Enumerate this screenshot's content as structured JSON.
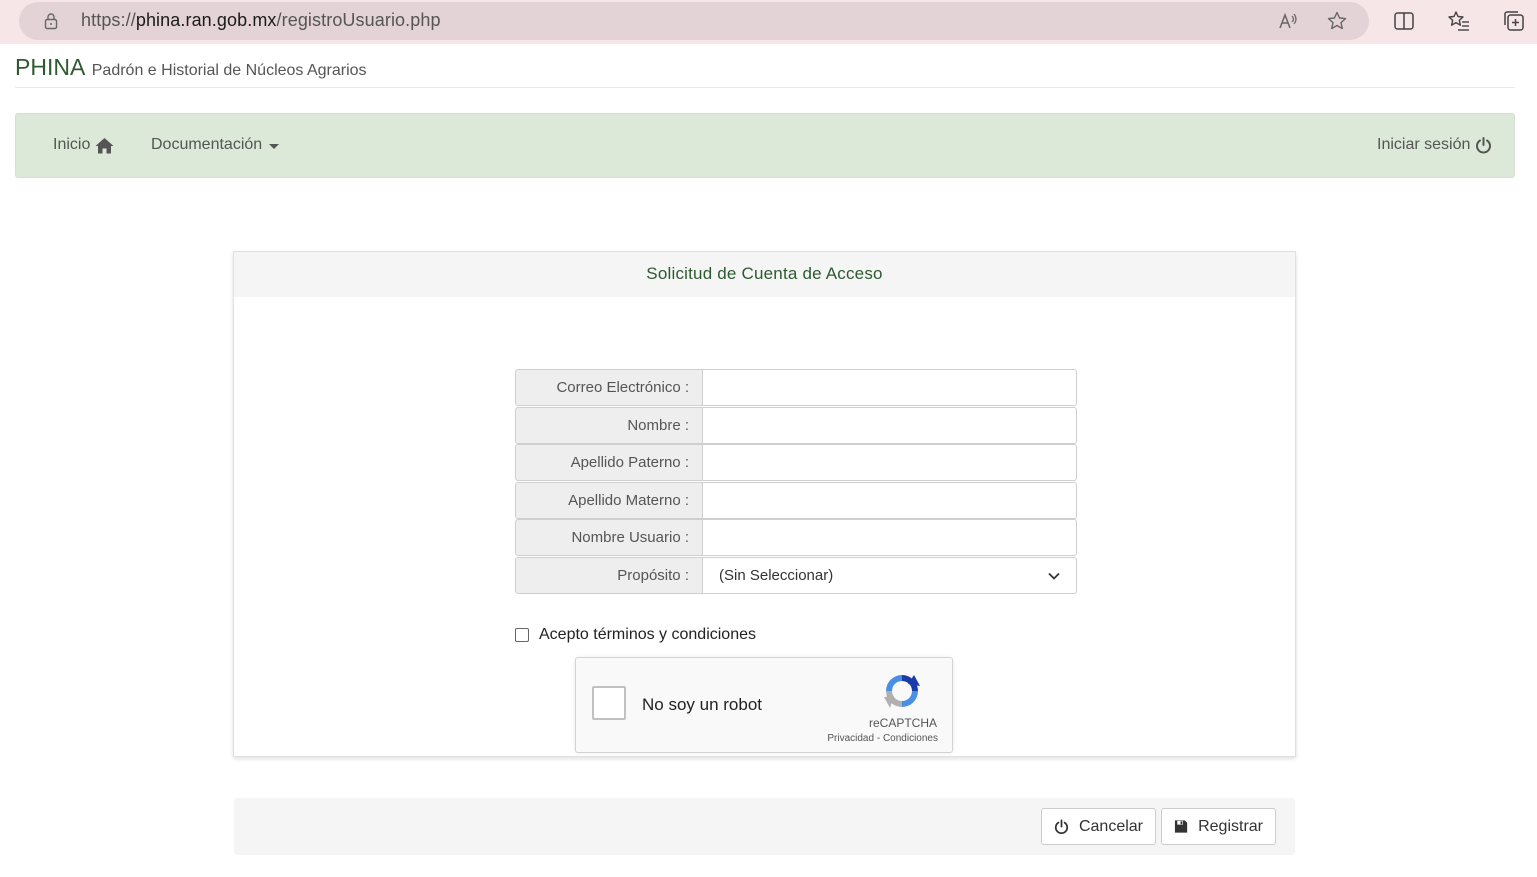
{
  "browser": {
    "url_scheme": "https://",
    "url_host": "phina.ran.gob.mx",
    "url_path": "/registroUsuario.php"
  },
  "header": {
    "brand_name": "PHINA",
    "brand_subtitle": "Padrón e Historial de Núcleos Agrarios"
  },
  "nav": {
    "home_label": "Inicio",
    "docs_label": "Documentación",
    "login_label": "Iniciar sesión"
  },
  "panel": {
    "title": "Solicitud de Cuenta de Acceso",
    "fields": [
      {
        "label": "Correo Electrónico :",
        "value": ""
      },
      {
        "label": "Nombre :",
        "value": ""
      },
      {
        "label": "Apellido Paterno :",
        "value": ""
      },
      {
        "label": "Apellido Materno :",
        "value": ""
      },
      {
        "label": "Nombre Usuario :",
        "value": ""
      }
    ],
    "purpose": {
      "label": "Propósito :",
      "selected": "(Sin Seleccionar)"
    },
    "terms_label": "Acepto términos y condiciones",
    "captcha": {
      "label": "No soy un robot",
      "brand": "reCAPTCHA",
      "privacy": "Privacidad",
      "separator": " - ",
      "terms": "Condiciones"
    }
  },
  "actions": {
    "cancel_label": "Cancelar",
    "register_label": "Registrar"
  },
  "colors": {
    "brand_green": "#2e5a30",
    "navbar_bg": "#dce9d8",
    "browser_bar": "#f6e6e8"
  }
}
